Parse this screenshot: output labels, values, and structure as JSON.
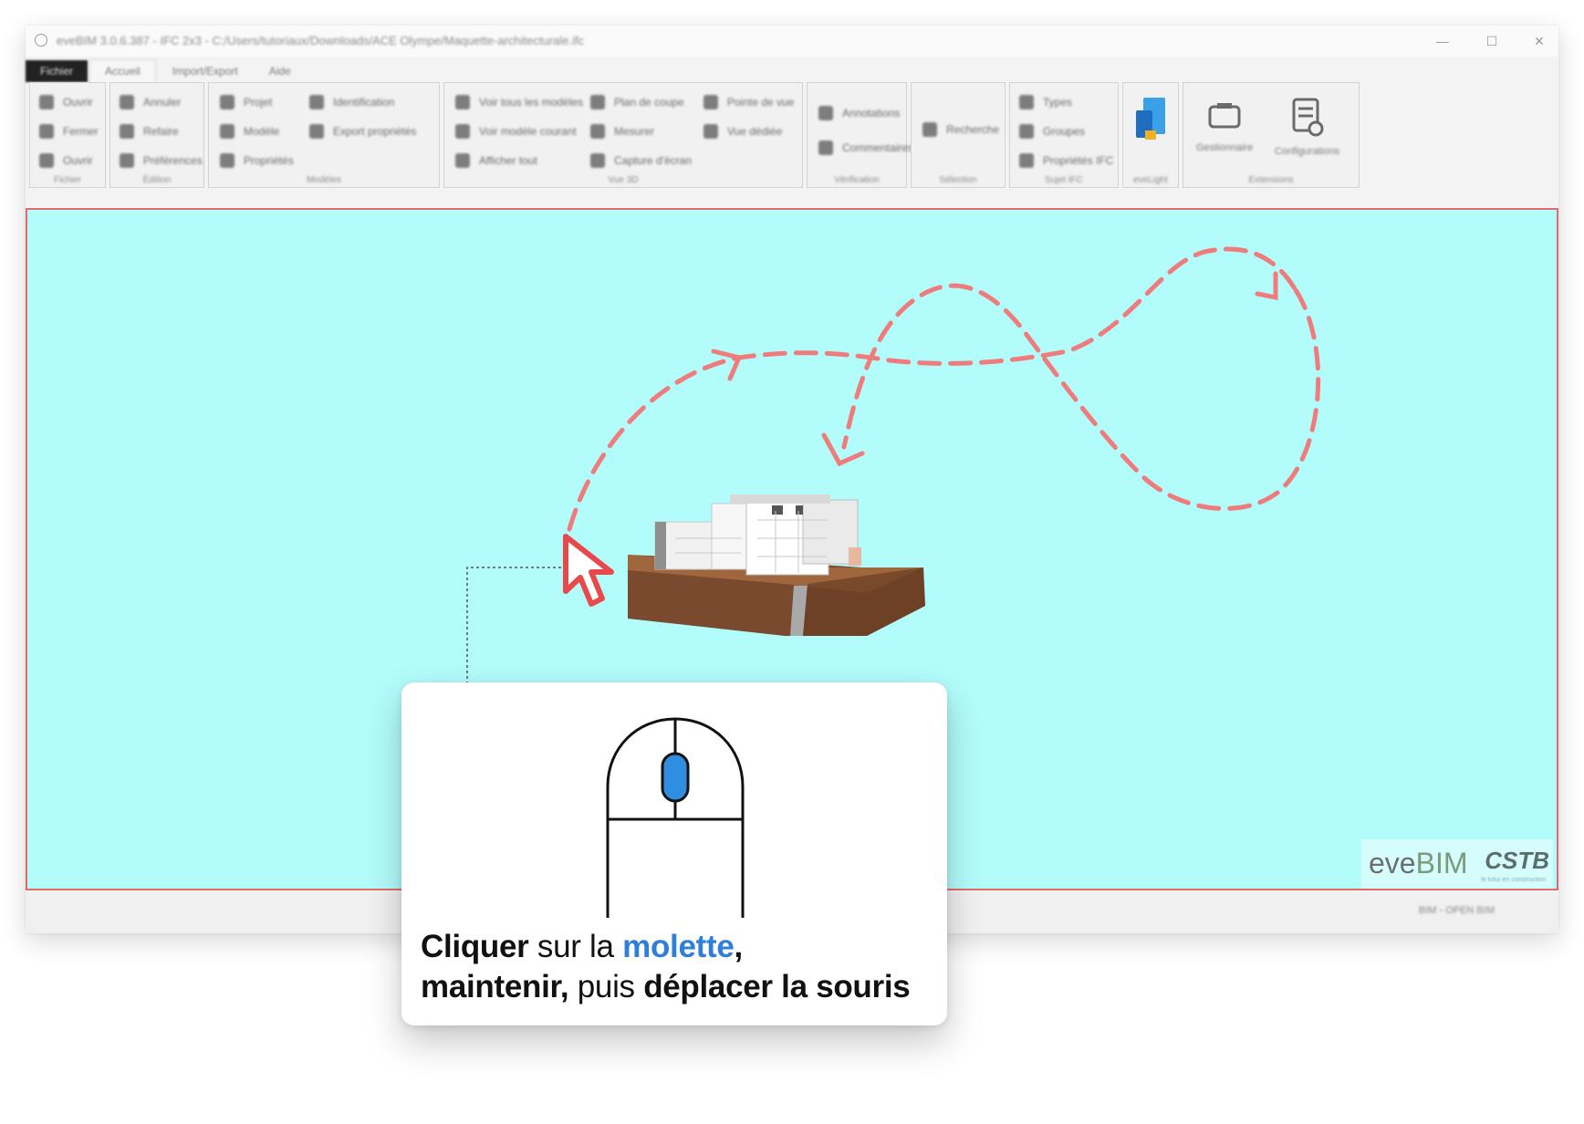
{
  "window": {
    "title": "eveBIM 3.0.6.387 - IFC 2x3 - C:/Users/tutoriaux/Downloads/ACE Olympe/Maquette-architecturale.ifc",
    "controls": [
      "—",
      "☐",
      "✕"
    ]
  },
  "ribbon": {
    "tabs": [
      "Fichier",
      "Accueil",
      "Import/Export",
      "Aide"
    ],
    "groups": [
      {
        "name": "Fichier",
        "items": [
          "Ouvrir",
          "Fermer",
          "Ouvrir"
        ]
      },
      {
        "name": "Édition",
        "items": [
          "Annuler",
          "Refaire",
          "Préférences"
        ]
      },
      {
        "name": "Modèles",
        "items": [
          "Projet",
          "Modèle",
          "Propriétés",
          "Identification",
          "Export propriétés"
        ]
      },
      {
        "name": "Vue 3D",
        "items": [
          "Voir tous les modèles",
          "Voir modèle courant",
          "Afficher tout",
          "Plan de coupe",
          "Mesurer",
          "Capture d'écran",
          "Pointe de vue",
          "Vue dédiée"
        ]
      },
      {
        "name": "Vérification",
        "items": [
          "Annotations",
          "Commentaires"
        ]
      },
      {
        "name": "Sélection",
        "items": [
          "Recherche"
        ]
      },
      {
        "name": "Sujet IFC",
        "items": [
          "Types",
          "Groupes",
          "Propriétés IFC"
        ]
      },
      {
        "name": "eveLight",
        "items": []
      },
      {
        "name": "Extensions",
        "items": [
          "Gestionnaire",
          "Configurations"
        ]
      }
    ]
  },
  "statusbar": {
    "right_text": "BIM - OPEN BIM"
  },
  "branding": {
    "eve": "eve",
    "bim": "BIM",
    "cstb": "CSTB",
    "cstb_sub": "le futur en construction"
  },
  "instruction": {
    "part1_bold": "Cliquer",
    "part2": " sur la ",
    "part3_blue": "molette",
    "part4": ",",
    "part5_bold": "maintenir,",
    "part6": " puis ",
    "part7_bold": "déplacer la souris"
  },
  "colors": {
    "viewport_bg": "#b2fcfb",
    "viewport_border": "#e46a6a",
    "path_dash": "#ef7b7b",
    "wheel_blue": "#2f8ee0",
    "text_blue": "#2f7ed8"
  }
}
